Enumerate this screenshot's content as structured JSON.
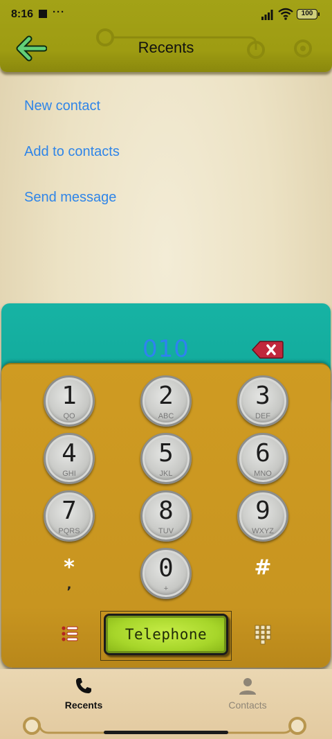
{
  "status_bar": {
    "time": "8:16",
    "more": "···",
    "battery": "100"
  },
  "header": {
    "title": "Recents"
  },
  "menu": {
    "items": [
      {
        "label": "New contact"
      },
      {
        "label": "Add to contacts"
      },
      {
        "label": "Send message"
      }
    ]
  },
  "dialer": {
    "number": "010",
    "keys": [
      {
        "digit": "1",
        "letters": "QO"
      },
      {
        "digit": "2",
        "letters": "ABC"
      },
      {
        "digit": "3",
        "letters": "DEF"
      },
      {
        "digit": "4",
        "letters": "GHI"
      },
      {
        "digit": "5",
        "letters": "JKL"
      },
      {
        "digit": "6",
        "letters": "MNO"
      },
      {
        "digit": "7",
        "letters": "PQRS"
      },
      {
        "digit": "8",
        "letters": "TUV"
      },
      {
        "digit": "9",
        "letters": "WXYZ"
      },
      {
        "digit": "0",
        "letters": "+"
      }
    ],
    "star": {
      "main": "*",
      "sub": ","
    },
    "hash": {
      "main": "#"
    },
    "call_label": "Telephone"
  },
  "bottom_nav": {
    "items": [
      {
        "label": "Recents",
        "icon": "phone-icon",
        "active": true
      },
      {
        "label": "Contacts",
        "icon": "person-icon",
        "active": false
      }
    ]
  },
  "colors": {
    "header": "#9e9c12",
    "display_panel": "#11a899",
    "keypad_panel": "#c89520",
    "link": "#2f85e8",
    "call_button": "#a7d62a",
    "delete_button": "#c0283c"
  }
}
